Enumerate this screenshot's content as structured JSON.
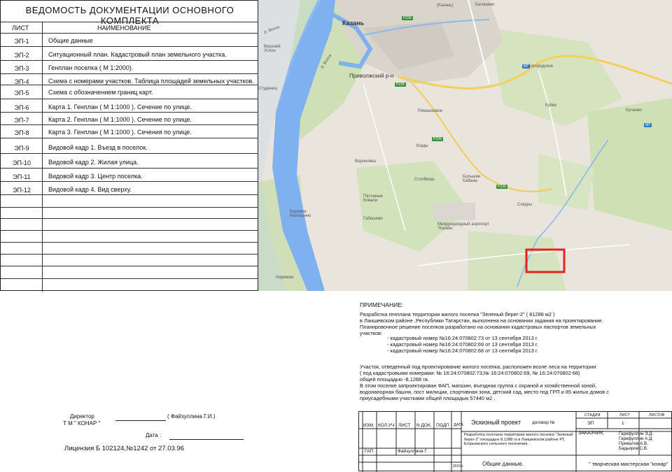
{
  "sheet": {
    "title": "ВЕДОМОСТЬ ДОКУМЕНТАЦИИ ОСНОВНОГО КОМПЛЕКТА",
    "col_code": "ЛИСТ",
    "col_name": "НАИМЕНОВАНИЕ",
    "rows": [
      {
        "code": "ЭП-1",
        "name": "Общие  данные"
      },
      {
        "code": "ЭП-2",
        "name": "Ситуационный план. Кадастровый план земельного участка."
      },
      {
        "code": "ЭП-3",
        "name": "Генплан   поселка ( М 1:2000)."
      },
      {
        "code": "ЭП-4",
        "name": "Схема с номерами участков. Таблица площадей земельных участков."
      },
      {
        "code": "ЭП-5",
        "name": "Схема с обозначением границ карт."
      },
      {
        "code": "ЭП-6",
        "name": "Карта 1. Генплан   ( М 1:1000 ). Сечение по улице."
      },
      {
        "code": "ЭП-7",
        "name": "Карта 2.  Генплан ( М 1:1000 ).  Сечение по улице."
      },
      {
        "code": "ЭП-8",
        "name": "Карта 3.  Генплан ( М 1:1000 ).  Сечения по улице."
      },
      {
        "code": "ЭП-9",
        "name": "Видовой кадр 1. Въезд в поселок."
      },
      {
        "code": "ЭП-10",
        "name": "Видовой  кадр 2. Жилая улица."
      },
      {
        "code": "ЭП-11",
        "name": "Видовой  кадр 3. Центр поселка."
      },
      {
        "code": "ЭП-12",
        "name": "Видовой кадр 4. Вид сверху."
      }
    ]
  },
  "map": {
    "labels": {
      "kazan": "Казань",
      "kazan_top": "(Казань)",
      "volga1": "р. Волга",
      "volga2": "р. Волга",
      "privolzhsky": "Приволжский р-н",
      "verkhny_uslon": "Верхний Услон",
      "studenets": "Студенец",
      "bogorodskoe": "Богородское",
      "kuykі": "Куйки",
      "kulaevo": "Кулаево",
      "romashkovoe": "Ромашковое",
      "usady": "Усады",
      "voronovka": "Вороновка",
      "stolbishche": "Столбище",
      "bolshie_kabany": "Большие Кабаны",
      "peschanye_kovali": "Песчаные Ковали",
      "gabishevo": "Габишево",
      "borovoe_matyushino": "Боровое Матюшино",
      "airport": "Международный аэропорт \"Казань\"",
      "sokury": "Сокуры",
      "nariman": "Нариман",
      "begishevo": "Бегишево",
      "m7a": "M7",
      "m7b": "M7",
      "p239a": "P239",
      "p239b": "P239",
      "p239c": "P239",
      "p239d": "P239"
    }
  },
  "notes": {
    "heading": "ПРИМЕЧАНИЕ:",
    "lines": [
      "Разработка генплана территории жилого  поселка \"Зеленый берег-2\" ( 81288 м2 )",
      "в  Лаишевском районе ,Республики Татарстан,  выполнена  на  основании  задания  на проектирование.",
      "Планировочное  решение поселков  разработано   на  основании кадастровых паспортов земельных",
      "участков:"
    ],
    "cadastre": [
      "- кадастровый номер №16:24:070802:73    от 13 сентября 2013 г.",
      "- кадастровый номер №16:24:070802:69    от 13 сентября 2013 г.",
      "- кадастровый номер №16:24:070802:68    от 13 сентября 2013 г."
    ],
    "para2": [
      " Участок, отведенный под проектирование жилого поселка,  расположен   возле  леса на территории",
      " ( под кадастровыми номерами:  №  16:24:070802:73,№ 16:24:070802:69,  № 16:24:070802:68)",
      "  общей площадью -8,1288 га.",
      "В этом поселке запроектирован ФАП, магазин, въездная группа с охраной и хозяйственной зоной,",
      "водонапорная башня, пост милиции, спортивная зона, детский сад, место под ГРП  и  85 жилых домов  с",
      "приусадебными  участками общей площадью 57440 м2 ."
    ]
  },
  "signature": {
    "director": "Директор",
    "company": "Т М \" КОНАР \"",
    "name": "( Файзуллина Г.И.)",
    "date_label": "Дата :",
    "license": "Лицензия Б 102124,№1242 от 27.03.96"
  },
  "stamp": {
    "izm": "ИЗМ.",
    "kol_uch": "КОЛ.УЧ",
    "list": "ЛИСТ",
    "n_dok": "N ДОК.",
    "podp": "ПОДП",
    "data": "ДАТА",
    "stage_title": "Эскизный проект",
    "contract": "договор №",
    "stadia_h": "СТАДИЯ",
    "list_h": "ЛИСТ",
    "listov_h": "ЛИСТОВ",
    "stadia_v": "ЭП",
    "list_v": "1",
    "description": "Разработка генплана территории жилого  поселка \"Зеленый берег-2\" площадью  8,1288 га  в  Лаишевском районе РТ, Егорьевского сельского поселения.",
    "customer_label": "ЗАКАЗЧИК:",
    "customers": [
      "Гарифуллин Э.Д.",
      "Гарифуллин А.Д.",
      "Привалов  А.В.",
      "Бадьяров  С.В."
    ],
    "gap_label": "ГАП",
    "gap_name": "Файзуллина Г.",
    "year": "2015 г.",
    "sheet_name": "Общие  данные.",
    "studio": "\" творческая  мастерская \"конар\""
  }
}
